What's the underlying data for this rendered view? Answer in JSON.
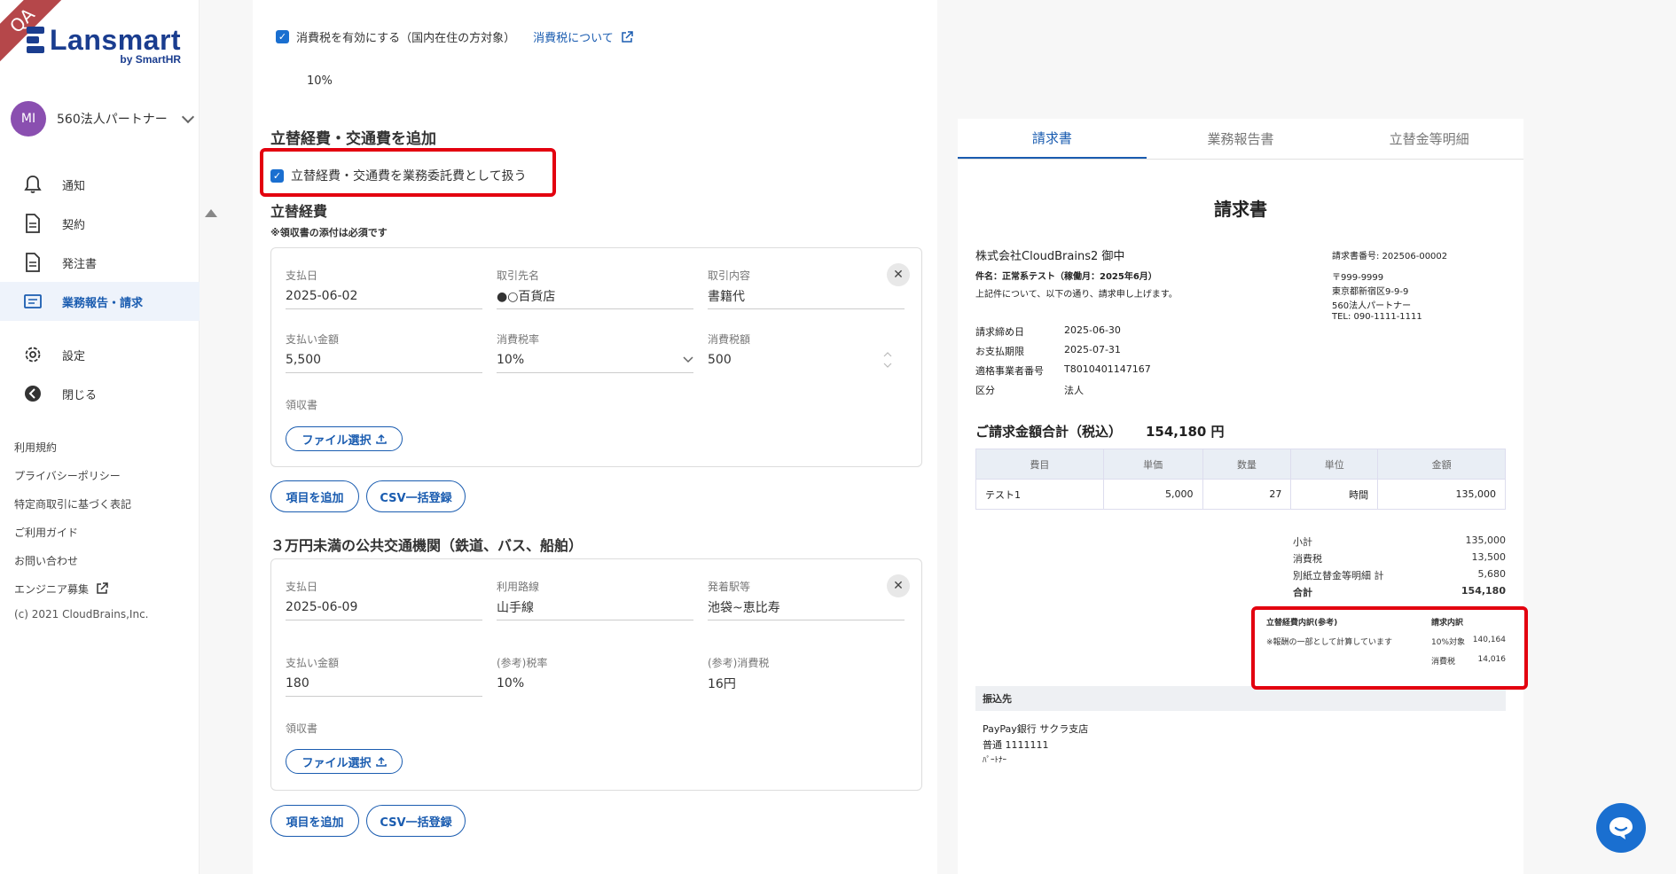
{
  "ribbon": "QA",
  "logo": {
    "title": "Lansmart",
    "sub": "by SmartHR"
  },
  "org": {
    "initials": "MI",
    "name": "560法人パートナー"
  },
  "nav": [
    {
      "label": "通知",
      "icon": "bell-icon"
    },
    {
      "label": "契約",
      "icon": "document-icon"
    },
    {
      "label": "発注書",
      "icon": "document-icon"
    },
    {
      "label": "業務報告・請求",
      "icon": "folder-icon",
      "active": true
    },
    {
      "label": "設定",
      "icon": "gear-icon"
    },
    {
      "label": "閉じる",
      "icon": "back-arrow-icon"
    }
  ],
  "links": [
    "利用規約",
    "プライバシーポリシー",
    "特定商取引に基づく表記",
    "ご利用ガイド",
    "お問い合わせ",
    "エンジニア募集"
  ],
  "copyright": "(c) 2021 CloudBrains,Inc.",
  "form": {
    "tax_checkbox_label": "消費税を有効にする（国内在住の方対象）",
    "tax_link": "消費税について",
    "tax_rate": "10%",
    "expense_section_title": "立替経費・交通費を追加",
    "expense_checkbox_label": "立替経費・交通費を業務委託費として扱う",
    "expense_title": "立替経費",
    "expense_note": "※領収書の添付は必須です",
    "expense": {
      "date_label": "支払日",
      "date": "2025-06-02",
      "vendor_label": "取引先名",
      "vendor": "●○百貨店",
      "content_label": "取引内容",
      "content": "書籍代",
      "amount_label": "支払い金額",
      "amount": "5,500",
      "rate_label": "消費税率",
      "rate": "10%",
      "tax_label": "消費税額",
      "tax": "500",
      "receipt_label": "領収書",
      "file_button": "ファイル選択"
    },
    "add_item": "項目を追加",
    "csv_button": "CSV一括登録",
    "transport_title": "３万円未満の公共交通機関（鉄道、バス、船舶）",
    "transport": {
      "date_label": "支払日",
      "date": "2025-06-09",
      "route_label": "利用路線",
      "route": "山手線",
      "station_label": "発着駅等",
      "station": "池袋~恵比寿",
      "amount_label": "支払い金額",
      "amount": "180",
      "rate_label": "(参考)税率",
      "rate": "10%",
      "tax_label": "(参考)消費税",
      "tax": "16円",
      "receipt_label": "領収書",
      "file_button": "ファイル選択"
    }
  },
  "preview": {
    "tabs": [
      "請求書",
      "業務報告書",
      "立替金等明細"
    ],
    "title": "請求書",
    "client": "株式会社CloudBrains2 御中",
    "subject": "件名：正常系テスト（稼働月：2025年6月）",
    "intro": "上記件について、以下の通り、請求申し上げます。",
    "invoice_no": "請求書番号: 202506-00002",
    "postal": "〒999-9999",
    "address": "東京都新宿区9-9-9",
    "issuer": "560法人パートナー",
    "tel": "TEL: 090-1111-1111",
    "meta": [
      {
        "k": "請求締め日",
        "v": "2025-06-30"
      },
      {
        "k": "お支払期限",
        "v": "2025-07-31"
      },
      {
        "k": "適格事業者番号",
        "v": "T8010401147167"
      },
      {
        "k": "区分",
        "v": "法人"
      }
    ],
    "total_label": "ご請求金額合計（税込）",
    "total_value": "154,180 円",
    "table_headers": [
      "費目",
      "単価",
      "数量",
      "単位",
      "金額"
    ],
    "table_rows": [
      [
        "テスト1",
        "5,000",
        "27",
        "時間",
        "135,000"
      ]
    ],
    "summary": [
      {
        "k": "小計",
        "v": "135,000"
      },
      {
        "k": "消費税",
        "v": "13,500"
      },
      {
        "k": "別紙立替金等明細 計",
        "v": "5,680"
      },
      {
        "k": "合計",
        "v": "154,180"
      }
    ],
    "breakdown": {
      "h1": "立替経費内訳(参考)",
      "h2": "請求内訳",
      "note": "※報酬の一部として計算しています",
      "r1k": "10%対象",
      "r1v": "140,164",
      "r2k": "消費税",
      "r2v": "14,016"
    },
    "bank_label": "振込先",
    "bank_lines": [
      "PayPay銀行 サクラ支店",
      "普通 1111111",
      "ﾊﾟｰﾄﾅｰ"
    ]
  }
}
